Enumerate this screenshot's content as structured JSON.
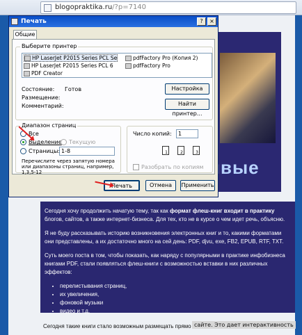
{
  "browser": {
    "url_host": "blogopraktika.ru",
    "url_path": "/?p=7140"
  },
  "banner": {
    "text": "ивые"
  },
  "dialog": {
    "title": "Печать",
    "close_glyph": "×",
    "help_glyph": "?",
    "tab": "Общие",
    "printer_group_title": "Выберите принтер",
    "printers": [
      "HP LaserJet P2015 Series PCL Se",
      "pdfFactory Pro (Копия 2)",
      "HP LaserJet P2015 Series PCL 6",
      "pdfFactory Pro",
      "PDF Creator"
    ],
    "status_label": "Состояние:",
    "status_value": "Готов",
    "location_label": "Размещение:",
    "comment_label": "Комментарий:",
    "settings_button": "Настройка",
    "find_printer_button": "Найти принтер...",
    "range_group_title": "Диапазон страниц",
    "range_all": "Все",
    "range_selection": "Выделение",
    "range_current": "Текущую страницу",
    "range_pages": "Страницы:",
    "pages_value": "1-8",
    "pages_hint": "Перечислите через запятую номера или диапазоны страниц, например, 1,3,5-12",
    "copies_label": "Число копий:",
    "copies_value": "1",
    "collate_label": "Разобрать по копиям",
    "collate_pages": [
      "1",
      "2",
      "3"
    ],
    "print_button": "Печать",
    "cancel_button": "Отмена",
    "apply_button": "Применить"
  },
  "article": {
    "p1_a": "Сегодня хочу продолжить начатую тему, так как ",
    "p1_bold": "формат флеш-книг входит в практику",
    "p1_b": " блогов, сайтов, а также интернет-бизнеса. Для тех, кто не в курсе о чем идет речь, объясню.",
    "p2": "Я не буду рассказывать историю возникновения электронных книг и то, какими форматами они представлены, а их достаточно много на сей день: PDF, djvu, exe, FB2, EPUB, RTF, TXT.",
    "p3": "Суть моего поста в том, чтобы показать, как наряду с популярными в практике инфобизнеса книгами PDF, стали появляться флеш-книги с возможностью вставки в них различных эффектов:",
    "bullets": [
      "перелистывания страниц,",
      "их увеличения,",
      "фоновой музыки",
      "видео и т.д."
    ],
    "below_text": "Сегодня такие книги стало возможным размещать прямо на",
    "watermark": "сайте. Это дает интерактивность"
  },
  "colors": {
    "accent": "#2a2770",
    "stripe": "#1a5aa8",
    "arrow": "#e02020",
    "titlebar": "#0a4ec7"
  }
}
